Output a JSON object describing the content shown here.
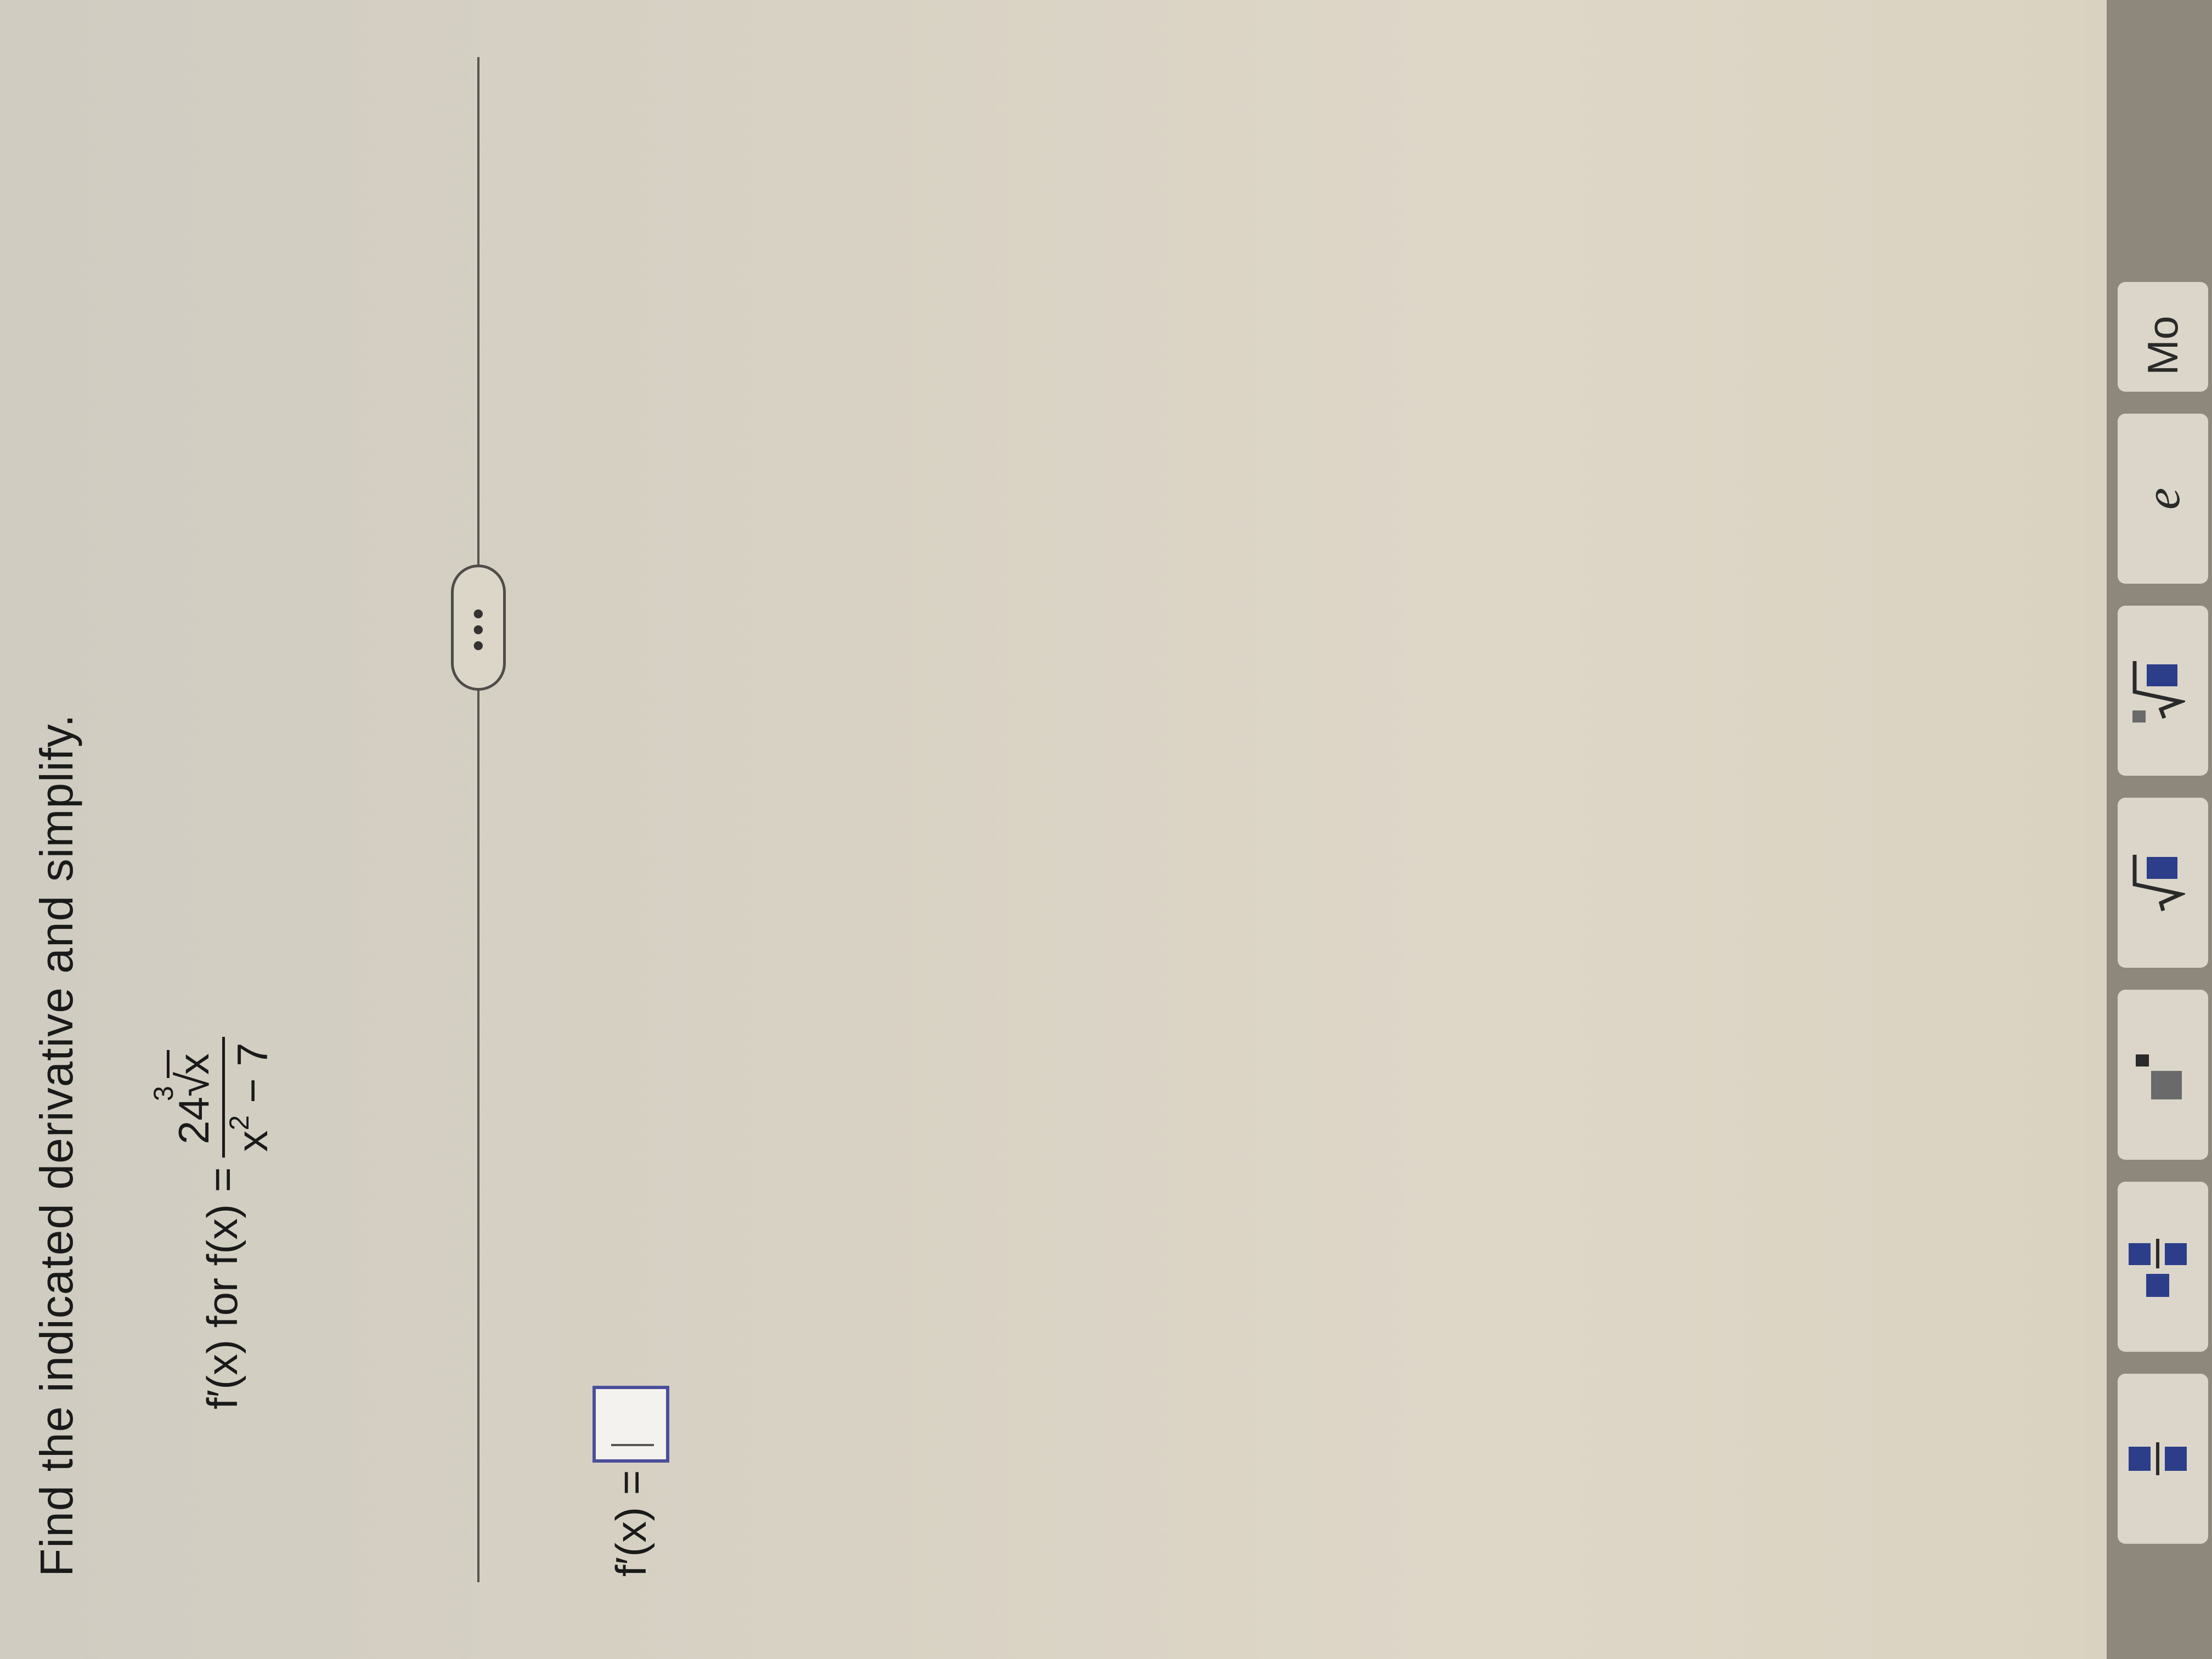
{
  "question": {
    "instruction": "Find the indicated derivative and simplify.",
    "prompt_prefix": "f′(x) for f(x) =",
    "numerator_coef": "24",
    "root_index": "3",
    "root_radicand": "x",
    "denominator_base": "x",
    "denominator_exp": "2",
    "denominator_rest": " − 7"
  },
  "more_button": {
    "label": "•••"
  },
  "answer": {
    "label": "f′(x) ="
  },
  "toolbar": {
    "buttons": [
      {
        "name": "fraction-icon"
      },
      {
        "name": "mixed-number-icon"
      },
      {
        "name": "exponent-icon"
      },
      {
        "name": "square-root-icon",
        "label": "√▪"
      },
      {
        "name": "nth-root-icon",
        "label": "∛▪"
      },
      {
        "name": "e-constant",
        "label": "e"
      },
      {
        "name": "more-toolbar-button",
        "label": "Mo"
      }
    ]
  }
}
